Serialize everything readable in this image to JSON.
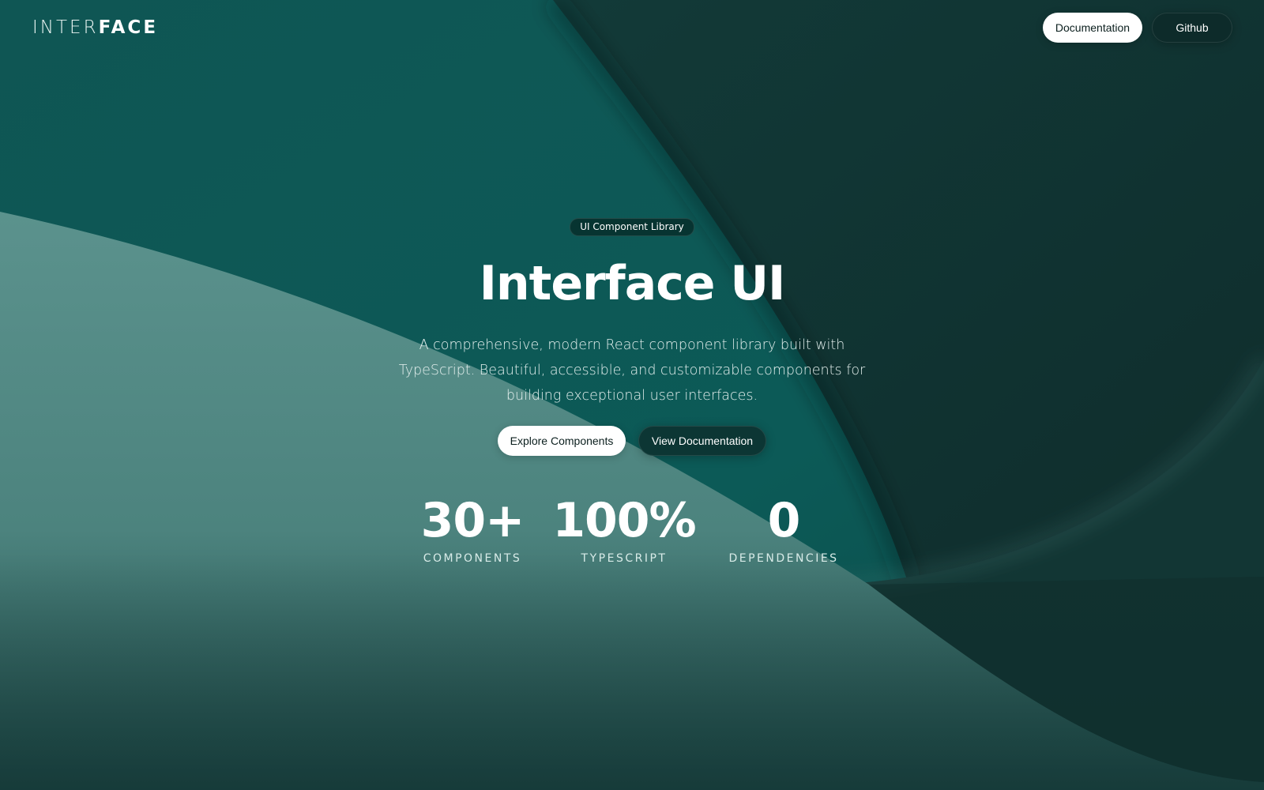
{
  "header": {
    "logo_light": "INTER",
    "logo_bold": "FACE",
    "nav": {
      "documentation_label": "Documentation",
      "github_label": "Github"
    }
  },
  "hero": {
    "badge": "UI Component Library",
    "title": "Interface UI",
    "subtitle": "A comprehensive, modern React component library built with TypeScript. Beautiful, accessible, and customizable components for building exceptional user interfaces.",
    "primary_cta": "Explore Components",
    "secondary_cta": "View Documentation"
  },
  "stats": [
    {
      "value": "30+",
      "label": "COMPONENTS"
    },
    {
      "value": "100%",
      "label": "TYPESCRIPT"
    },
    {
      "value": "0",
      "label": "DEPENDENCIES"
    }
  ],
  "colors": {
    "teal_mid": "#0e5755",
    "teal_dark": "#0f2e2d",
    "teal_light": "#538b86",
    "button_light": "#ffffff",
    "button_dark": "#0d2b2a"
  }
}
